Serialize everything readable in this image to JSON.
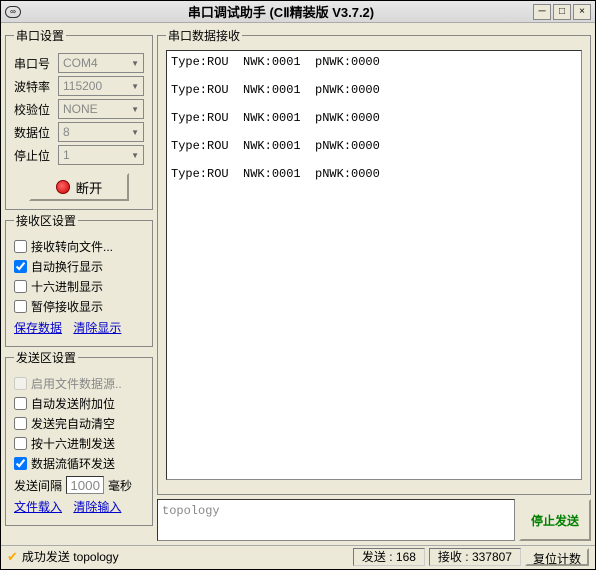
{
  "title": "串口调试助手 (CⅡ精装版 V3.7.2)",
  "port_settings": {
    "legend": "串口设置",
    "port": {
      "label": "串口号",
      "value": "COM4"
    },
    "baud": {
      "label": "波特率",
      "value": "115200"
    },
    "parity": {
      "label": "校验位",
      "value": "NONE"
    },
    "data": {
      "label": "数据位",
      "value": "8"
    },
    "stop": {
      "label": "停止位",
      "value": "1"
    },
    "disconnect": "断开"
  },
  "recv_settings": {
    "legend": "接收区设置",
    "to_file": "接收转向文件...",
    "auto_wrap": "自动换行显示",
    "hex": "十六进制显示",
    "pause": "暂停接收显示",
    "save": "保存数据",
    "clear": "清除显示"
  },
  "send_settings": {
    "legend": "发送区设置",
    "file_src": "启用文件数据源..",
    "auto_append": "自动发送附加位",
    "auto_clear": "发送完自动清空",
    "hex_send": "按十六进制发送",
    "loop_send": "数据流循环发送",
    "interval_label": "发送间隔",
    "interval_value": "1000",
    "interval_unit": "毫秒",
    "file_load": "文件载入",
    "clear_input": "清除输入"
  },
  "recv_area": {
    "legend": "串口数据接收",
    "lines": "Type:ROU  NWK:0001  pNWK:0000\n\nType:ROU  NWK:0001  pNWK:0000\n\nType:ROU  NWK:0001  pNWK:0000\n\nType:ROU  NWK:0001  pNWK:0000\n\nType:ROU  NWK:0001  pNWK:0000\n"
  },
  "send_area": {
    "input": "topology",
    "button": "停止发送"
  },
  "statusbar": {
    "status": "成功发送 topology",
    "tx_label": "发送 :",
    "tx_value": "168",
    "rx_label": "接收 :",
    "rx_value": "337807",
    "reset": "复位计数"
  }
}
